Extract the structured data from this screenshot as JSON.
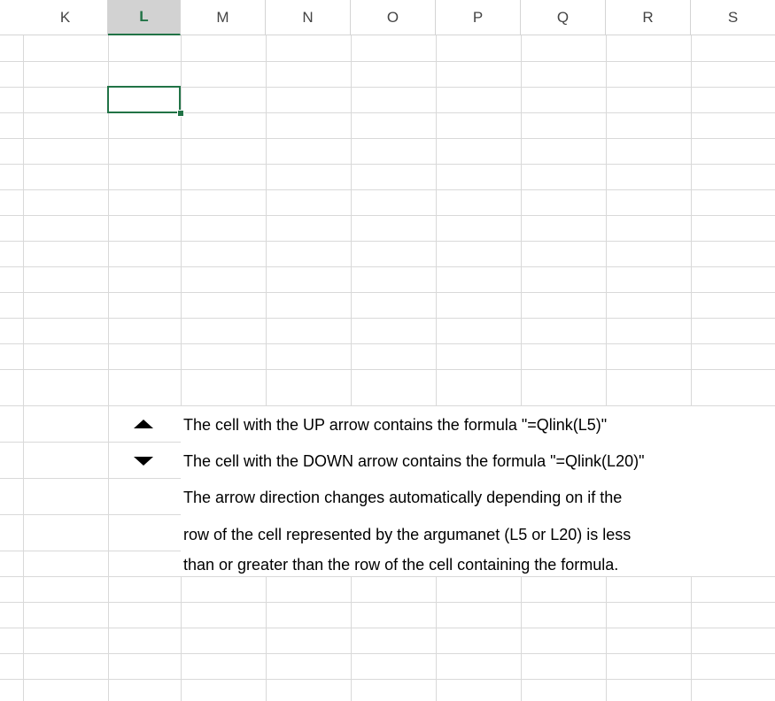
{
  "columns": [
    "K",
    "L",
    "M",
    "N",
    "O",
    "P",
    "Q",
    "R",
    "S"
  ],
  "selected_column": "L",
  "active_cell": "L3",
  "notes": {
    "up_text": "The cell with the UP arrow contains the formula \"=Qlink(L5)\"",
    "down_text": "The cell with the DOWN arrow contains the formula \"=Qlink(L20)\"",
    "line3": "The arrow direction changes automatically depending on if the",
    "line4": "row of the cell represented by the argumanet (L5 or L20) is less",
    "line5": "than or greater than the row of the cell containing the formula."
  },
  "colors": {
    "selection_green": "#217346",
    "gridline": "#d9d9d9",
    "header_selected_bg": "#d2d2d2"
  },
  "icons": {
    "up_arrow": "up-triangle",
    "down_arrow": "down-triangle"
  }
}
